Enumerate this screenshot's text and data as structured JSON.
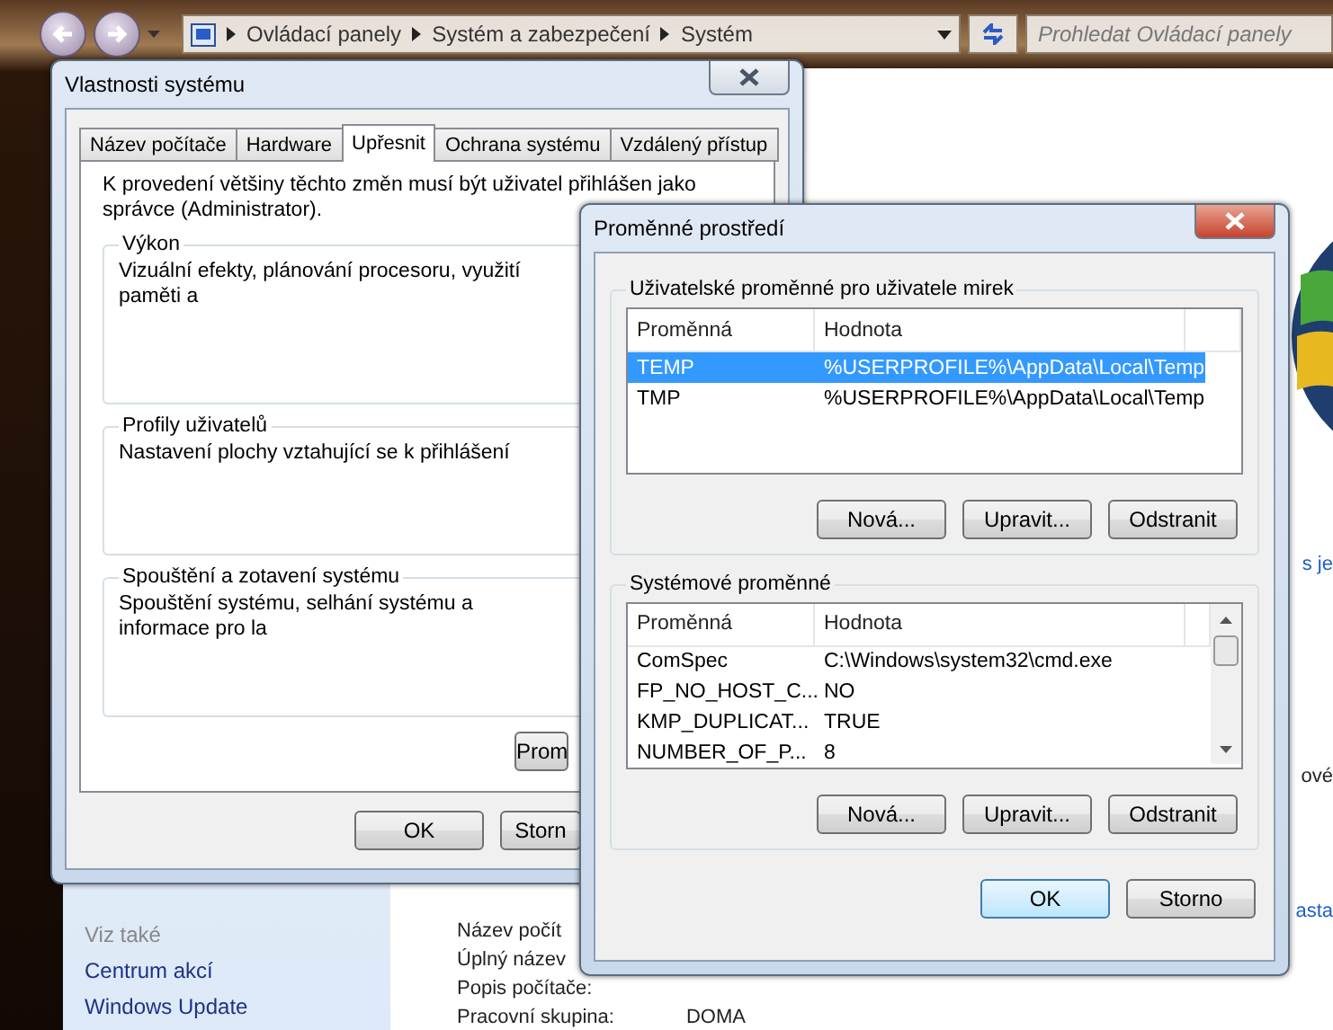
{
  "explorer": {
    "breadcrumb": [
      "Ovládací panely",
      "Systém a zabezpečení",
      "Systém"
    ],
    "search": {
      "placeholder": "Prohledat Ovládací panely"
    },
    "see_also": {
      "heading": "Viz také",
      "links": [
        "Centrum akcí",
        "Windows Update"
      ]
    },
    "info_rows": [
      {
        "label": "Název počít"
      },
      {
        "label": "Úplný název"
      },
      {
        "label": "Popis počítače:"
      },
      {
        "label": "Pracovní skupina:",
        "value": "DOMA"
      }
    ],
    "fragments": [
      {
        "kind": "link",
        "text": "s je"
      },
      {
        "kind": "text",
        "text": "ové"
      },
      {
        "kind": "link",
        "text": "asta"
      }
    ]
  },
  "system_properties": {
    "title": "Vlastnosti systému",
    "tabs": [
      {
        "label": "Název počítače",
        "selected": false
      },
      {
        "label": "Hardware",
        "selected": false
      },
      {
        "label": "Upřesnit",
        "selected": true
      },
      {
        "label": "Ochrana systému",
        "selected": false
      },
      {
        "label": "Vzdálený přístup",
        "selected": false
      }
    ],
    "note": "K provedení většiny těchto změn musí být uživatel přihlášen jako správce (Administrator).",
    "groups": [
      {
        "title": "Výkon",
        "text": "Vizuální efekty, plánování procesoru, využití paměti a"
      },
      {
        "title": "Profily uživatelů",
        "text": "Nastavení plochy vztahující se k přihlášení"
      },
      {
        "title": "Spouštění a zotavení systému",
        "text": "Spouštění systému, selhání systému a informace pro la"
      }
    ],
    "variables_button": "Prom",
    "buttons": [
      {
        "label": "OK",
        "default": false
      },
      {
        "label": "Storn",
        "default": false
      }
    ]
  },
  "environment_variables": {
    "title": "Proměnné prostředí",
    "sections": [
      {
        "title": "Uživatelské proměnné pro uživatele mirek",
        "columns": [
          "Proměnná",
          "Hodnota"
        ],
        "scrollbar": false,
        "rows": [
          {
            "name": "TEMP",
            "value": "%USERPROFILE%\\AppData\\Local\\Temp",
            "selected": true
          },
          {
            "name": "TMP",
            "value": "%USERPROFILE%\\AppData\\Local\\Temp",
            "selected": false
          }
        ],
        "buttons": [
          "Nová...",
          "Upravit...",
          "Odstranit"
        ]
      },
      {
        "title": "Systémové proměnné",
        "columns": [
          "Proměnná",
          "Hodnota"
        ],
        "scrollbar": true,
        "rows": [
          {
            "name": "ComSpec",
            "value": "C:\\Windows\\system32\\cmd.exe",
            "selected": false
          },
          {
            "name": "FP_NO_HOST_C...",
            "value": "NO",
            "selected": false
          },
          {
            "name": "KMP_DUPLICAT...",
            "value": "TRUE",
            "selected": false
          },
          {
            "name": "NUMBER_OF_P...",
            "value": "8",
            "selected": false
          }
        ],
        "buttons": [
          "Nová...",
          "Upravit...",
          "Odstranit"
        ]
      }
    ],
    "buttons": [
      {
        "label": "OK",
        "default": true
      },
      {
        "label": "Storno",
        "default": false
      }
    ]
  }
}
